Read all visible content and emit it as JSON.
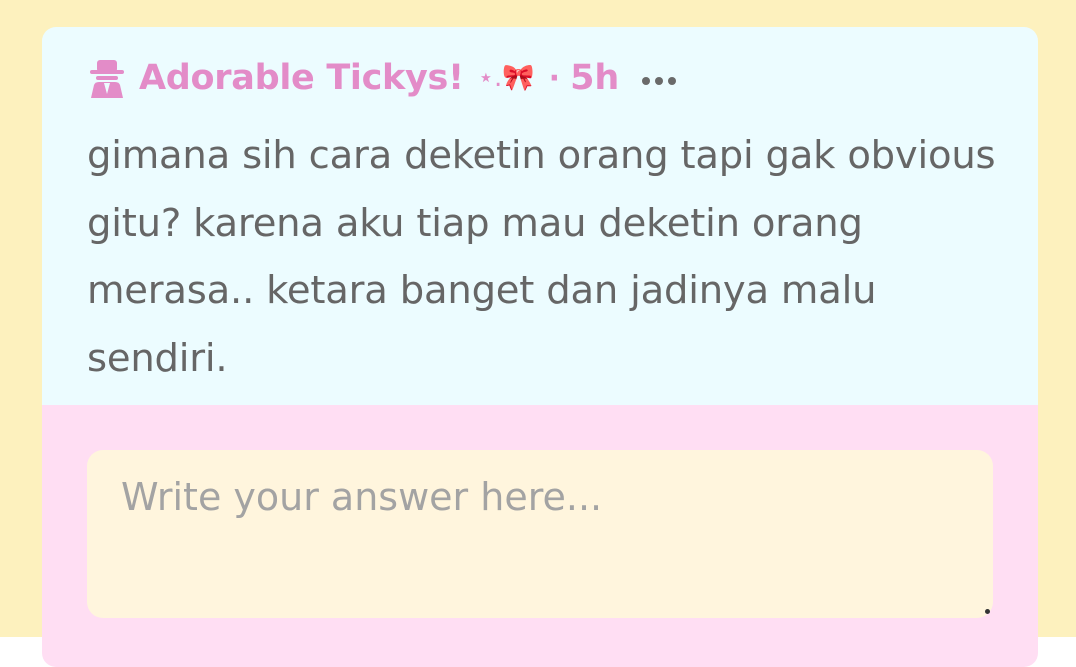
{
  "colors": {
    "page_background": "#fdf1be",
    "question_background": "#ecfcff",
    "answer_background": "#ffdef3",
    "answer_field_background": "#fff5dd",
    "username_color": "#e38cc8",
    "text_color": "#666666",
    "placeholder_color": "#a3a3a3",
    "more_icon_color": "#6a6a6a"
  },
  "post": {
    "avatar_icon": "spy-icon",
    "username": "Adorable Tickys!",
    "decoration": "⋆.🎀",
    "separator": "·",
    "time_ago": "5h",
    "more_icon": "more-dots-icon",
    "question": "gimana sih cara deketin orang tapi gak obvious gitu? karena aku tiap mau deketin orang merasa.. ketara banget dan jadinya malu sendiri."
  },
  "answer": {
    "placeholder": "Write your answer here...",
    "value": ""
  }
}
